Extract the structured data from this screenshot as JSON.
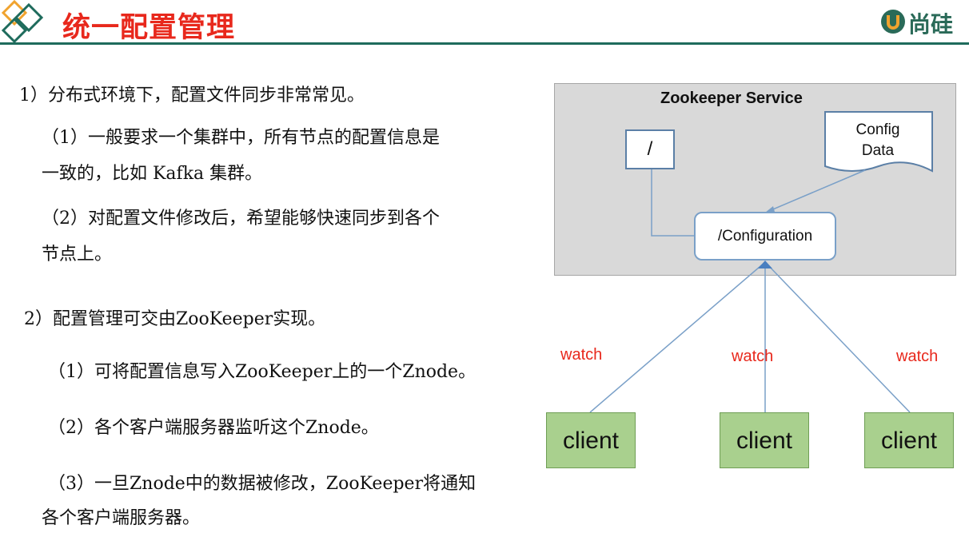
{
  "header": {
    "title": "统一配置管理",
    "logo_text": "尚硅"
  },
  "content": {
    "p1": "1）分布式环境下，配置文件同步非常常见。",
    "p1_1a": "（1）一般要求一个集群中，所有节点的配置信息是",
    "p1_1b": "一致的，比如 Kafka 集群。",
    "p1_2a": "（2）对配置文件修改后，希望能够快速同步到各个",
    "p1_2b": "节点上。",
    "p2": "2）配置管理可交由ZooKeeper实现。",
    "p2_1": "（1）可将配置信息写入ZooKeeper上的一个Znode。",
    "p2_2": "（2）各个客户端服务器监听这个Znode。",
    "p2_3a": "（3）一旦Znode中的数据被修改，ZooKeeper将通知",
    "p2_3b": "各个客户端服务器。"
  },
  "diagram": {
    "service_title": "Zookeeper Service",
    "root_node": "/",
    "config_node": "/Configuration",
    "config_data_line1": "Config",
    "config_data_line2": "Data",
    "clients": [
      "client",
      "client",
      "client"
    ],
    "watch_labels": [
      "watch",
      "watch",
      "watch"
    ]
  },
  "colors": {
    "title_red": "#e8281c",
    "header_line": "#1e6b5c",
    "client_green": "#a9d08e",
    "service_gray": "#d9d9d9",
    "arrow_blue": "#7aa0c8"
  }
}
